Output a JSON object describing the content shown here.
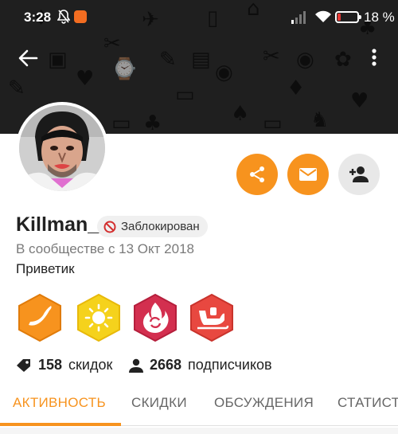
{
  "status_bar": {
    "time": "3:28",
    "battery_percent": "18 %",
    "battery_level": 0.18
  },
  "header": {
    "back_icon": "arrow-left-icon",
    "menu_icon": "more-vert-icon"
  },
  "profile": {
    "name": "Killman_",
    "blocked_label": "Заблокирован",
    "member_since": "В сообществе с 13 Окт 2018",
    "status_text": "Приветик"
  },
  "actions": [
    {
      "icon": "share-icon",
      "color": "#f7931e"
    },
    {
      "icon": "mail-icon",
      "color": "#f7931e"
    },
    {
      "icon": "add-friend-icon",
      "color": "#e8e8e8"
    }
  ],
  "badges": [
    {
      "icon": "banana-badge",
      "color": "#f7931e"
    },
    {
      "icon": "sun-badge",
      "color": "#f5d21c"
    },
    {
      "icon": "fire-badge",
      "color": "#d32f4f"
    },
    {
      "icon": "sleigh-badge",
      "color": "#e84840"
    }
  ],
  "stats": {
    "deals_count": "158",
    "deals_label": "скидок",
    "followers_count": "2668",
    "followers_label": "подписчиков"
  },
  "tabs": [
    {
      "label": "АКТИВНОСТЬ",
      "active": true
    },
    {
      "label": "СКИДКИ",
      "active": false
    },
    {
      "label": "ОБСУЖДЕНИЯ",
      "active": false
    },
    {
      "label": "СТАТИСТ",
      "active": false
    }
  ],
  "colors": {
    "accent": "#f7931e",
    "header_bg": "#1f1f1f"
  }
}
